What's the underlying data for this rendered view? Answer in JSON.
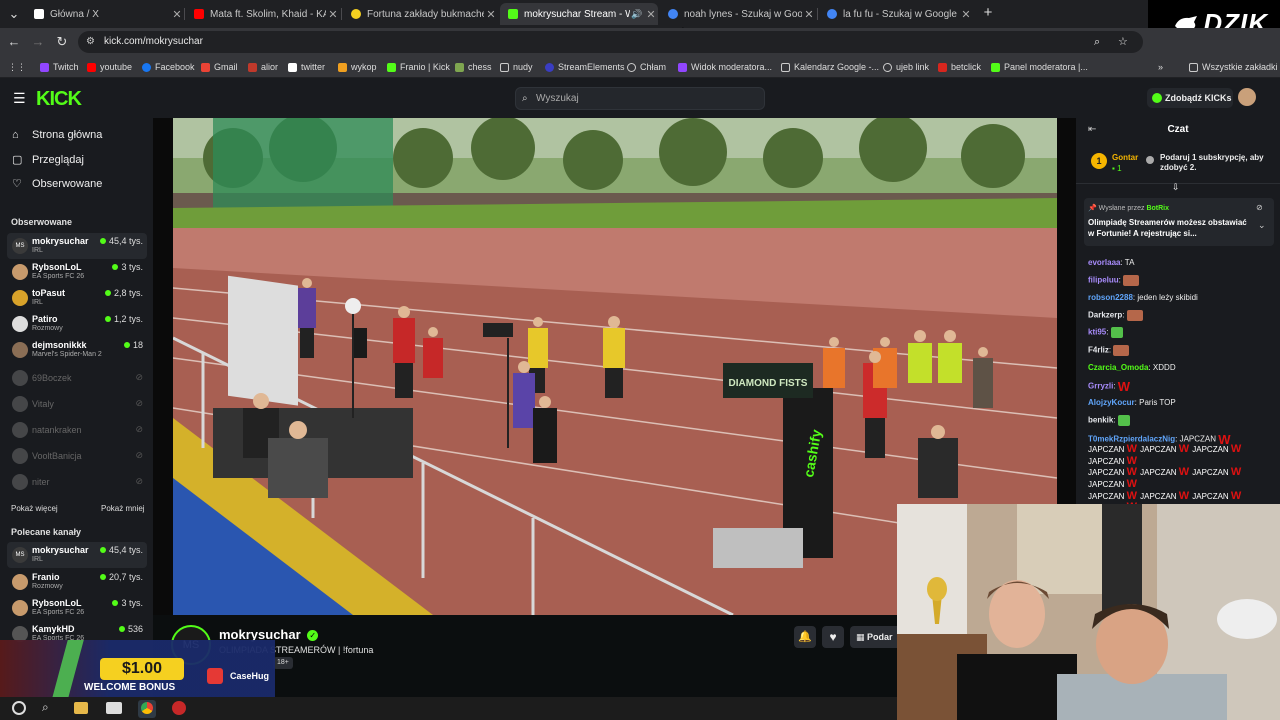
{
  "browser": {
    "tabs": [
      {
        "title": "Główna / X",
        "favicon": "x-icon",
        "color": "#ffffff"
      },
      {
        "title": "Mata ft. Skolim, Khaid - KAMIKAZE",
        "favicon": "youtube-icon",
        "color": "#ff0000"
      },
      {
        "title": "Fortuna zakłady bukmacherskie",
        "favicon": "fortuna-icon",
        "color": "#f5d020"
      },
      {
        "title": "mokrysuchar Stream - Watch",
        "favicon": "kick-icon",
        "color": "#53fc18"
      },
      {
        "title": "noah lynes - Szukaj w Google",
        "favicon": "google-icon",
        "color": "#4285f4"
      },
      {
        "title": "la fu fu - Szukaj w Google",
        "favicon": "google-icon",
        "color": "#4285f4"
      }
    ],
    "url": "kick.com/mokrysuchar",
    "bookmarks": [
      "Twitch",
      "youtube",
      "Facebook",
      "Gmail",
      "alior",
      "twitter",
      "wykop",
      "Franio | Kick",
      "chess",
      "nudy",
      "StreamElements",
      "Chłam",
      "Widok moderatora...",
      "Kalendarz Google -...",
      "ujeb link",
      "betclick",
      "Panel moderatora |..."
    ],
    "all_bookmarks": "Wszystkie zakładki"
  },
  "overlay": {
    "dzik_logo": "DZIK"
  },
  "kick": {
    "logo": "KICK",
    "search_placeholder": "Wyszukaj",
    "kicks_button": "Zdobądź KICKs"
  },
  "sidebar": {
    "nav": [
      "Strona główna",
      "Przeglądaj",
      "Obserwowane"
    ],
    "followed_title": "Obserwowane",
    "followed": [
      {
        "name": "mokrysuchar",
        "category": "IRL",
        "viewers": "45,4 tys.",
        "live": true
      },
      {
        "name": "RybsonLoL",
        "category": "EA Sports FC 26",
        "viewers": "3 tys.",
        "live": true
      },
      {
        "name": "toPasut",
        "category": "IRL",
        "viewers": "2,8 tys.",
        "live": true
      },
      {
        "name": "Patiro",
        "category": "Rozmowy",
        "viewers": "1,2 tys.",
        "live": true
      },
      {
        "name": "dejmsonikkk",
        "category": "Marvel's Spider-Man 2",
        "viewers": "18",
        "live": true
      },
      {
        "name": "69Boczek",
        "live": false
      },
      {
        "name": "Vitaly",
        "live": false
      },
      {
        "name": "natankraken",
        "live": false
      },
      {
        "name": "VooltBanicja",
        "live": false
      },
      {
        "name": "niter",
        "live": false
      }
    ],
    "show_more": "Pokaż więcej",
    "show_less": "Pokaż mniej",
    "recommended_title": "Polecane kanały",
    "recommended": [
      {
        "name": "mokrysuchar",
        "category": "IRL",
        "viewers": "45,4 tys."
      },
      {
        "name": "Franio",
        "category": "Rozmowy",
        "viewers": "20,7 tys."
      },
      {
        "name": "RybsonLoL",
        "category": "EA Sports FC 26",
        "viewers": "3 tys."
      },
      {
        "name": "KamykHD",
        "category": "EA Sports FC 26",
        "viewers": "536"
      }
    ]
  },
  "stream": {
    "channel": "mokrysuchar",
    "avatar_initials": "MS",
    "title": "OLIMPIADA STREAMERÓW | !fortuna",
    "age_badge": "18+",
    "gift_label": "Podar",
    "banner_text": "DIAMOND FISTS",
    "sponsor_text": "cashify"
  },
  "chat": {
    "title": "Czat",
    "leaderboard_name": "Gontar",
    "leaderboard_count": "1",
    "leaderboard_rank": "1",
    "gift_prompt": "Podaruj 1 subskrypcję, aby zdobyć 2.",
    "pinned_by": "Wysłane przez",
    "pinned_user": "BotRix",
    "pinned_text": "Olimpiadę Streamerów możesz obstawiać w Fortunie! A rejestrując si...",
    "messages": [
      {
        "user": "evorlaaa",
        "text": "TA",
        "color": "#a78bfa"
      },
      {
        "user": "filipeluu",
        "text": "",
        "color": "#a78bfa",
        "emote": true
      },
      {
        "user": "robson2288",
        "text": "jeden leży skibidi",
        "color": "#60a5fa"
      },
      {
        "user": "Darkzerp",
        "text": "",
        "color": "#e5e7eb",
        "emote": true
      },
      {
        "user": "kti95",
        "text": "",
        "color": "#a78bfa",
        "emote": true
      },
      {
        "user": "F4rliz",
        "text": "",
        "color": "#e5e7eb",
        "emote": true
      },
      {
        "user": "Czarcia_Omoda",
        "text": "XDDD",
        "color": "#53fc18"
      },
      {
        "user": "Grryzli",
        "text": "",
        "color": "#a78bfa",
        "wemote": true
      },
      {
        "user": "AlojzyKocur",
        "text": "Paris TOP",
        "color": "#60a5fa"
      },
      {
        "user": "benkik",
        "text": "",
        "color": "#e5e7eb",
        "emote": true
      },
      {
        "user": "T0mekRzpierdalaczNig",
        "text": "JAPCZAN",
        "color": "#60a5fa",
        "wemote": true
      }
    ],
    "spam_word": "JAPCZAN"
  },
  "ad": {
    "amount": "$1.00",
    "label": "WELCOME BONUS",
    "brand": "CaseHug"
  }
}
